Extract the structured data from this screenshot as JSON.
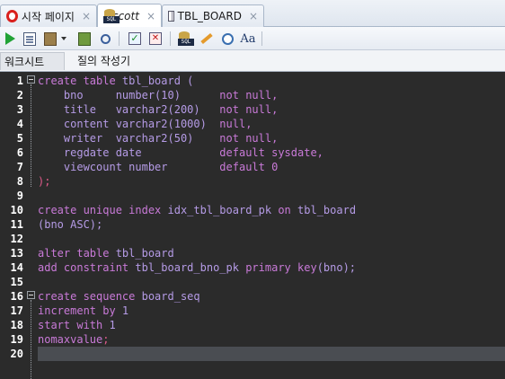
{
  "tabs": [
    {
      "label": "시작 페이지",
      "icon": "oracle-logo-icon",
      "close": "×",
      "active": false
    },
    {
      "label": "scott",
      "icon": "sql-worksheet-icon",
      "close": "×",
      "active": true
    },
    {
      "label": "TBL_BOARD",
      "icon": "table-grid-icon",
      "close": "×",
      "active": false
    }
  ],
  "toolbar": [
    "run-statement-icon",
    "run-script-icon",
    "autotrace-icon",
    "dropdown-caret-icon",
    "explain-plan-icon",
    "sql-tuning-icon",
    "commit-icon",
    "rollback-icon",
    "sql-history-icon",
    "clear-icon",
    "find-icon",
    "format-icon"
  ],
  "subtabs": [
    {
      "label": "워크시트",
      "active": true
    },
    {
      "label": "질의 작성기",
      "active": false
    }
  ],
  "editor": {
    "line_numbers": [
      "1",
      "2",
      "3",
      "4",
      "5",
      "6",
      "7",
      "8",
      "9",
      "10",
      "11",
      "12",
      "13",
      "14",
      "15",
      "16",
      "17",
      "18",
      "19",
      "20"
    ],
    "lines": [
      [
        [
          "kw",
          "create table "
        ],
        [
          "tx",
          "tbl_board ("
        ]
      ],
      [
        [
          "tx",
          "    bno     number(10)      "
        ],
        [
          "kw",
          "not null,"
        ]
      ],
      [
        [
          "tx",
          "    title   varchar2(200)   "
        ],
        [
          "kw",
          "not null,"
        ]
      ],
      [
        [
          "tx",
          "    content varchar2(1000)  "
        ],
        [
          "kw",
          "null,"
        ]
      ],
      [
        [
          "tx",
          "    writer  varchar2(50)    "
        ],
        [
          "kw",
          "not null,"
        ]
      ],
      [
        [
          "tx",
          "    regdate date            "
        ],
        [
          "kw",
          "default sysdate,"
        ]
      ],
      [
        [
          "tx",
          "    viewcount number        "
        ],
        [
          "kw",
          "default 0"
        ]
      ],
      [
        [
          "pn",
          ");"
        ]
      ],
      [
        [
          "tx",
          ""
        ]
      ],
      [
        [
          "kw",
          "create unique index "
        ],
        [
          "tx",
          "idx_tbl_board_pk "
        ],
        [
          "kw",
          "on "
        ],
        [
          "tx",
          "tbl_board"
        ]
      ],
      [
        [
          "tx",
          "(bno ASC);"
        ]
      ],
      [
        [
          "tx",
          ""
        ]
      ],
      [
        [
          "kw",
          "alter table "
        ],
        [
          "tx",
          "tbl_board"
        ]
      ],
      [
        [
          "kw",
          "add constraint "
        ],
        [
          "tx",
          "tbl_board_bno_pk "
        ],
        [
          "kw",
          "primary key"
        ],
        [
          "tx",
          "(bno);"
        ]
      ],
      [
        [
          "tx",
          ""
        ]
      ],
      [
        [
          "kw",
          "create sequence "
        ],
        [
          "tx",
          "board_seq"
        ]
      ],
      [
        [
          "kw",
          "increment by "
        ],
        [
          "tx",
          "1"
        ]
      ],
      [
        [
          "kw",
          "start with "
        ],
        [
          "tx",
          "1"
        ]
      ],
      [
        [
          "kw",
          "nomaxvalue"
        ],
        [
          "pn",
          ";"
        ]
      ],
      [
        [
          "tx",
          ""
        ]
      ]
    ],
    "current_line": 20,
    "colors": {
      "background": "#2b2b2b",
      "keyword": "#c97ad8",
      "text": "#b59be6",
      "punct": "#e05b8a",
      "current_line": "#4a4d52"
    }
  }
}
